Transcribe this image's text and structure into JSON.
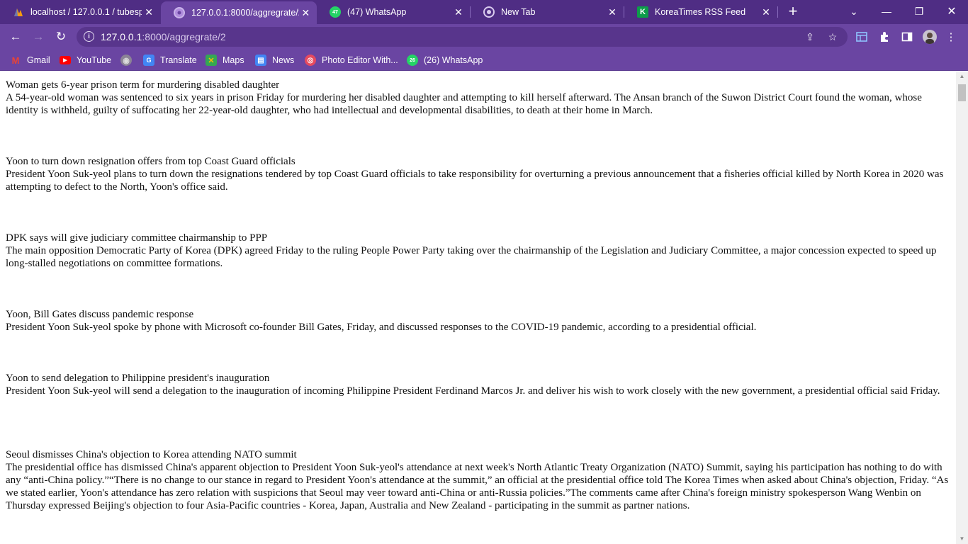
{
  "browser": {
    "tabs": [
      {
        "title": "localhost / 127.0.0.1 / tubesp",
        "icon": "phpmyadmin-icon",
        "active": false
      },
      {
        "title": "127.0.0.1:8000/aggregrate/2",
        "icon": "chrome-globe-icon",
        "active": true
      },
      {
        "title": "(47) WhatsApp",
        "icon": "whatsapp-icon",
        "badge": "47",
        "active": false
      },
      {
        "title": "New Tab",
        "icon": "chrome-icon",
        "active": false
      },
      {
        "title": "KoreaTimes RSS Feed",
        "icon": "koreatimes-icon",
        "badge": "K",
        "active": false
      }
    ],
    "address_bar": {
      "host": "127.0.0.1",
      "path": ":8000/aggregrate/2"
    },
    "bookmarks": [
      {
        "label": "Gmail",
        "icon": "gmail-icon",
        "glyph": "M"
      },
      {
        "label": "YouTube",
        "icon": "youtube-icon",
        "glyph": "▶"
      },
      {
        "label": "",
        "icon": "globe-icon",
        "glyph": "◉"
      },
      {
        "label": "Translate",
        "icon": "google-translate-icon",
        "glyph": "G"
      },
      {
        "label": "Maps",
        "icon": "google-maps-icon",
        "glyph": "✕"
      },
      {
        "label": "News",
        "icon": "google-news-icon",
        "glyph": "▤"
      },
      {
        "label": "Photo Editor With...",
        "icon": "photo-editor-icon",
        "glyph": "◎"
      },
      {
        "label": "(26) WhatsApp",
        "icon": "whatsapp-icon",
        "glyph": "26"
      }
    ],
    "colors": {
      "frame": "#4f2d84",
      "toolbar": "#6a45a2",
      "omnibox": "#58358c"
    }
  },
  "articles": [
    {
      "headline": "Woman gets 6-year prison term for murdering disabled daughter",
      "summary": "A 54-year-old woman was sentenced to six years in prison Friday for murdering her disabled daughter and attempting to kill herself afterward. The Ansan branch of the Suwon District Court found the woman, whose identity is withheld, guilty of suffocating her 22-year-old daughter, who had intellectual and developmental disabilities, to death at their home in March."
    },
    {
      "headline": "Yoon to turn down resignation offers from top Coast Guard officials",
      "summary": "President Yoon Suk-yeol plans to turn down the resignations tendered by top Coast Guard officials to take responsibility for overturning a previous announcement that a fisheries official killed by North Korea in 2020 was attempting to defect to the North, Yoon's office said."
    },
    {
      "headline": "DPK says will give judiciary committee chairmanship to PPP",
      "summary": "The main opposition Democratic Party of Korea (DPK) agreed Friday to the ruling People Power Party taking over the chairmanship of the Legislation and Judiciary Committee, a major concession expected to speed up long-stalled negotiations on committee formations."
    },
    {
      "headline": "Yoon, Bill Gates discuss pandemic response",
      "summary": "President Yoon Suk-yeol spoke by phone with Microsoft co-founder Bill Gates, Friday, and discussed responses to the COVID-19 pandemic, according to a presidential official."
    },
    {
      "headline": "Yoon to send delegation to Philippine president's inauguration",
      "summary": "President Yoon Suk-yeol will send a delegation to the inauguration of incoming Philippine President Ferdinand Marcos Jr. and deliver his wish to work closely with the new government, a presidential official said Friday."
    },
    {
      "headline": "Seoul dismisses China's objection to Korea attending NATO summit",
      "summary": "The presidential office has dismissed China's apparent objection to President Yoon Suk-yeol's attendance at next week's North Atlantic Treaty Organization (NATO) Summit, saying his participation has nothing to do with any “anti-China policy.”“There is no change to our stance in regard to President Yoon's attendance at the summit,” an official at the presidential office told The Korea Times when asked about China's objection, Friday. “As we stated earlier, Yoon's attendance has zero relation with suspicions that Seoul may veer toward anti-China or anti-Russia policies.”The comments came after China's foreign ministry spokesperson Wang Wenbin on Thursday expressed Beijing's objection to four Asia-Pacific countries - Korea, Japan, Australia and New Zealand - participating in the summit as partner nations."
    }
  ]
}
